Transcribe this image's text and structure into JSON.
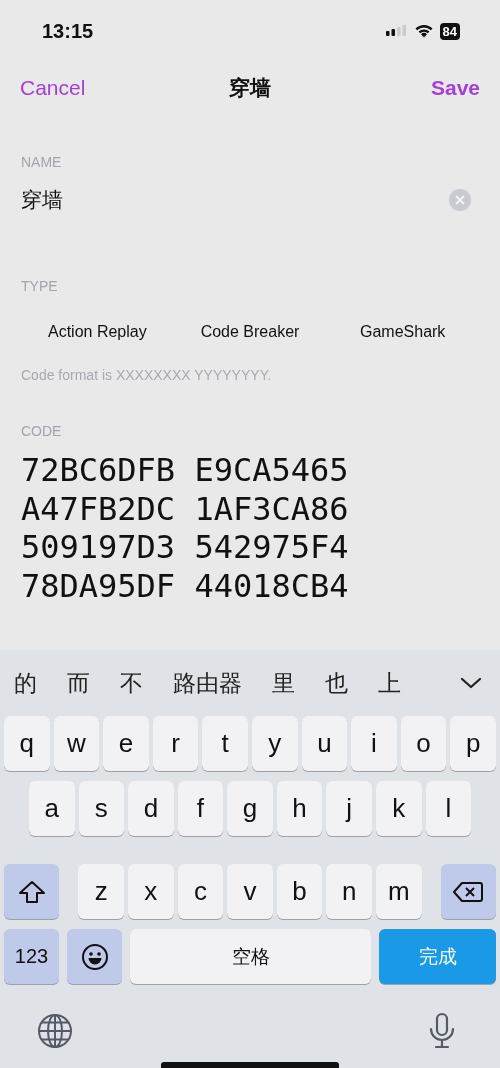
{
  "status_bar": {
    "time": "13:15",
    "battery": "84"
  },
  "nav": {
    "cancel": "Cancel",
    "title": "穿墙",
    "save": "Save"
  },
  "name_section": {
    "label": "NAME",
    "value": "穿墙"
  },
  "type_section": {
    "label": "TYPE",
    "options": [
      {
        "label": "Action Replay",
        "selected": false
      },
      {
        "label": "Code Breaker",
        "selected": false
      },
      {
        "label": "GameShark",
        "selected": false
      }
    ],
    "hint": "Code format is XXXXXXXX YYYYYYYY."
  },
  "code_section": {
    "label": "CODE",
    "value": "72BC6DFB E9CA5465\nA47FB2DC 1AF3CA86\n509197D3 542975F4\n78DA95DF 44018CB4"
  },
  "keyboard": {
    "candidates": [
      "的",
      "而",
      "不",
      "路由器",
      "里",
      "也",
      "上"
    ],
    "letter_rows": [
      [
        "q",
        "w",
        "e",
        "r",
        "t",
        "y",
        "u",
        "i",
        "o",
        "p"
      ],
      [
        "a",
        "s",
        "d",
        "f",
        "g",
        "h",
        "j",
        "k",
        "l"
      ],
      [
        "z",
        "x",
        "c",
        "v",
        "b",
        "n",
        "m"
      ]
    ],
    "bottom_keys": {
      "numbers": "123",
      "space": "空格",
      "done": "完成"
    }
  }
}
